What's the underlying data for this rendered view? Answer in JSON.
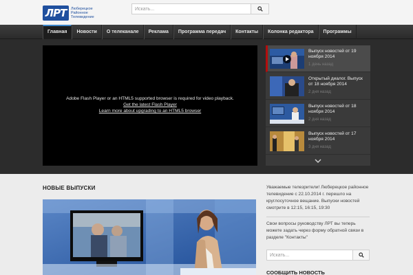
{
  "header": {
    "logo_mark": "ЛРТ",
    "logo_text": [
      "Люберецкое",
      "Районное",
      "Телевидение"
    ],
    "search_placeholder": "Искать..."
  },
  "nav": {
    "items": [
      "Главная",
      "Новости",
      "О телеканале",
      "Реклама",
      "Программа передач",
      "Контакты",
      "Колонка редактора",
      "Программы"
    ],
    "active_index": 0
  },
  "player": {
    "message": "Adobe Flash Player or an HTML5 supported browser is required for video playback.",
    "link1": "Get the latest Flash Player",
    "link2": "Learn more about upgrading to an HTML5 browser"
  },
  "playlist": {
    "items": [
      {
        "title": "Выпуск новостей от 19 ноября 2014",
        "date": "1 день назад"
      },
      {
        "title": "Открытый диалог. Выпуск от 18 ноября 2014",
        "date": "2 дня назад"
      },
      {
        "title": "Выпуск новостей от 18 ноября 2014",
        "date": "2 дня назад"
      },
      {
        "title": "Выпуск новостей от 17 ноября 2014",
        "date": "3 дня назад"
      }
    ]
  },
  "main": {
    "section_title": "НОВЫЕ ВЫПУСКИ"
  },
  "sidebar": {
    "notice": "Уважаемые телезрители! Люберецкое районное телевидение с 22.10.2014 г. перешло на круглосуточное вещание. Выпуски новостей смотрите в 12:15, 16:15, 19:30",
    "contact_note": "Свои вопросы руководству ЛРТ вы теперь можете задать через форму обратной связи в разделе \"Контакты\"",
    "search_placeholder": "Искать...",
    "heading": "СООБЩИТЬ НОВОСТЬ"
  },
  "colors": {
    "brand_blue": "#1f4f9e",
    "nav_active_accent": "#3a84c8",
    "playlist_active_accent": "#b40d0d"
  }
}
